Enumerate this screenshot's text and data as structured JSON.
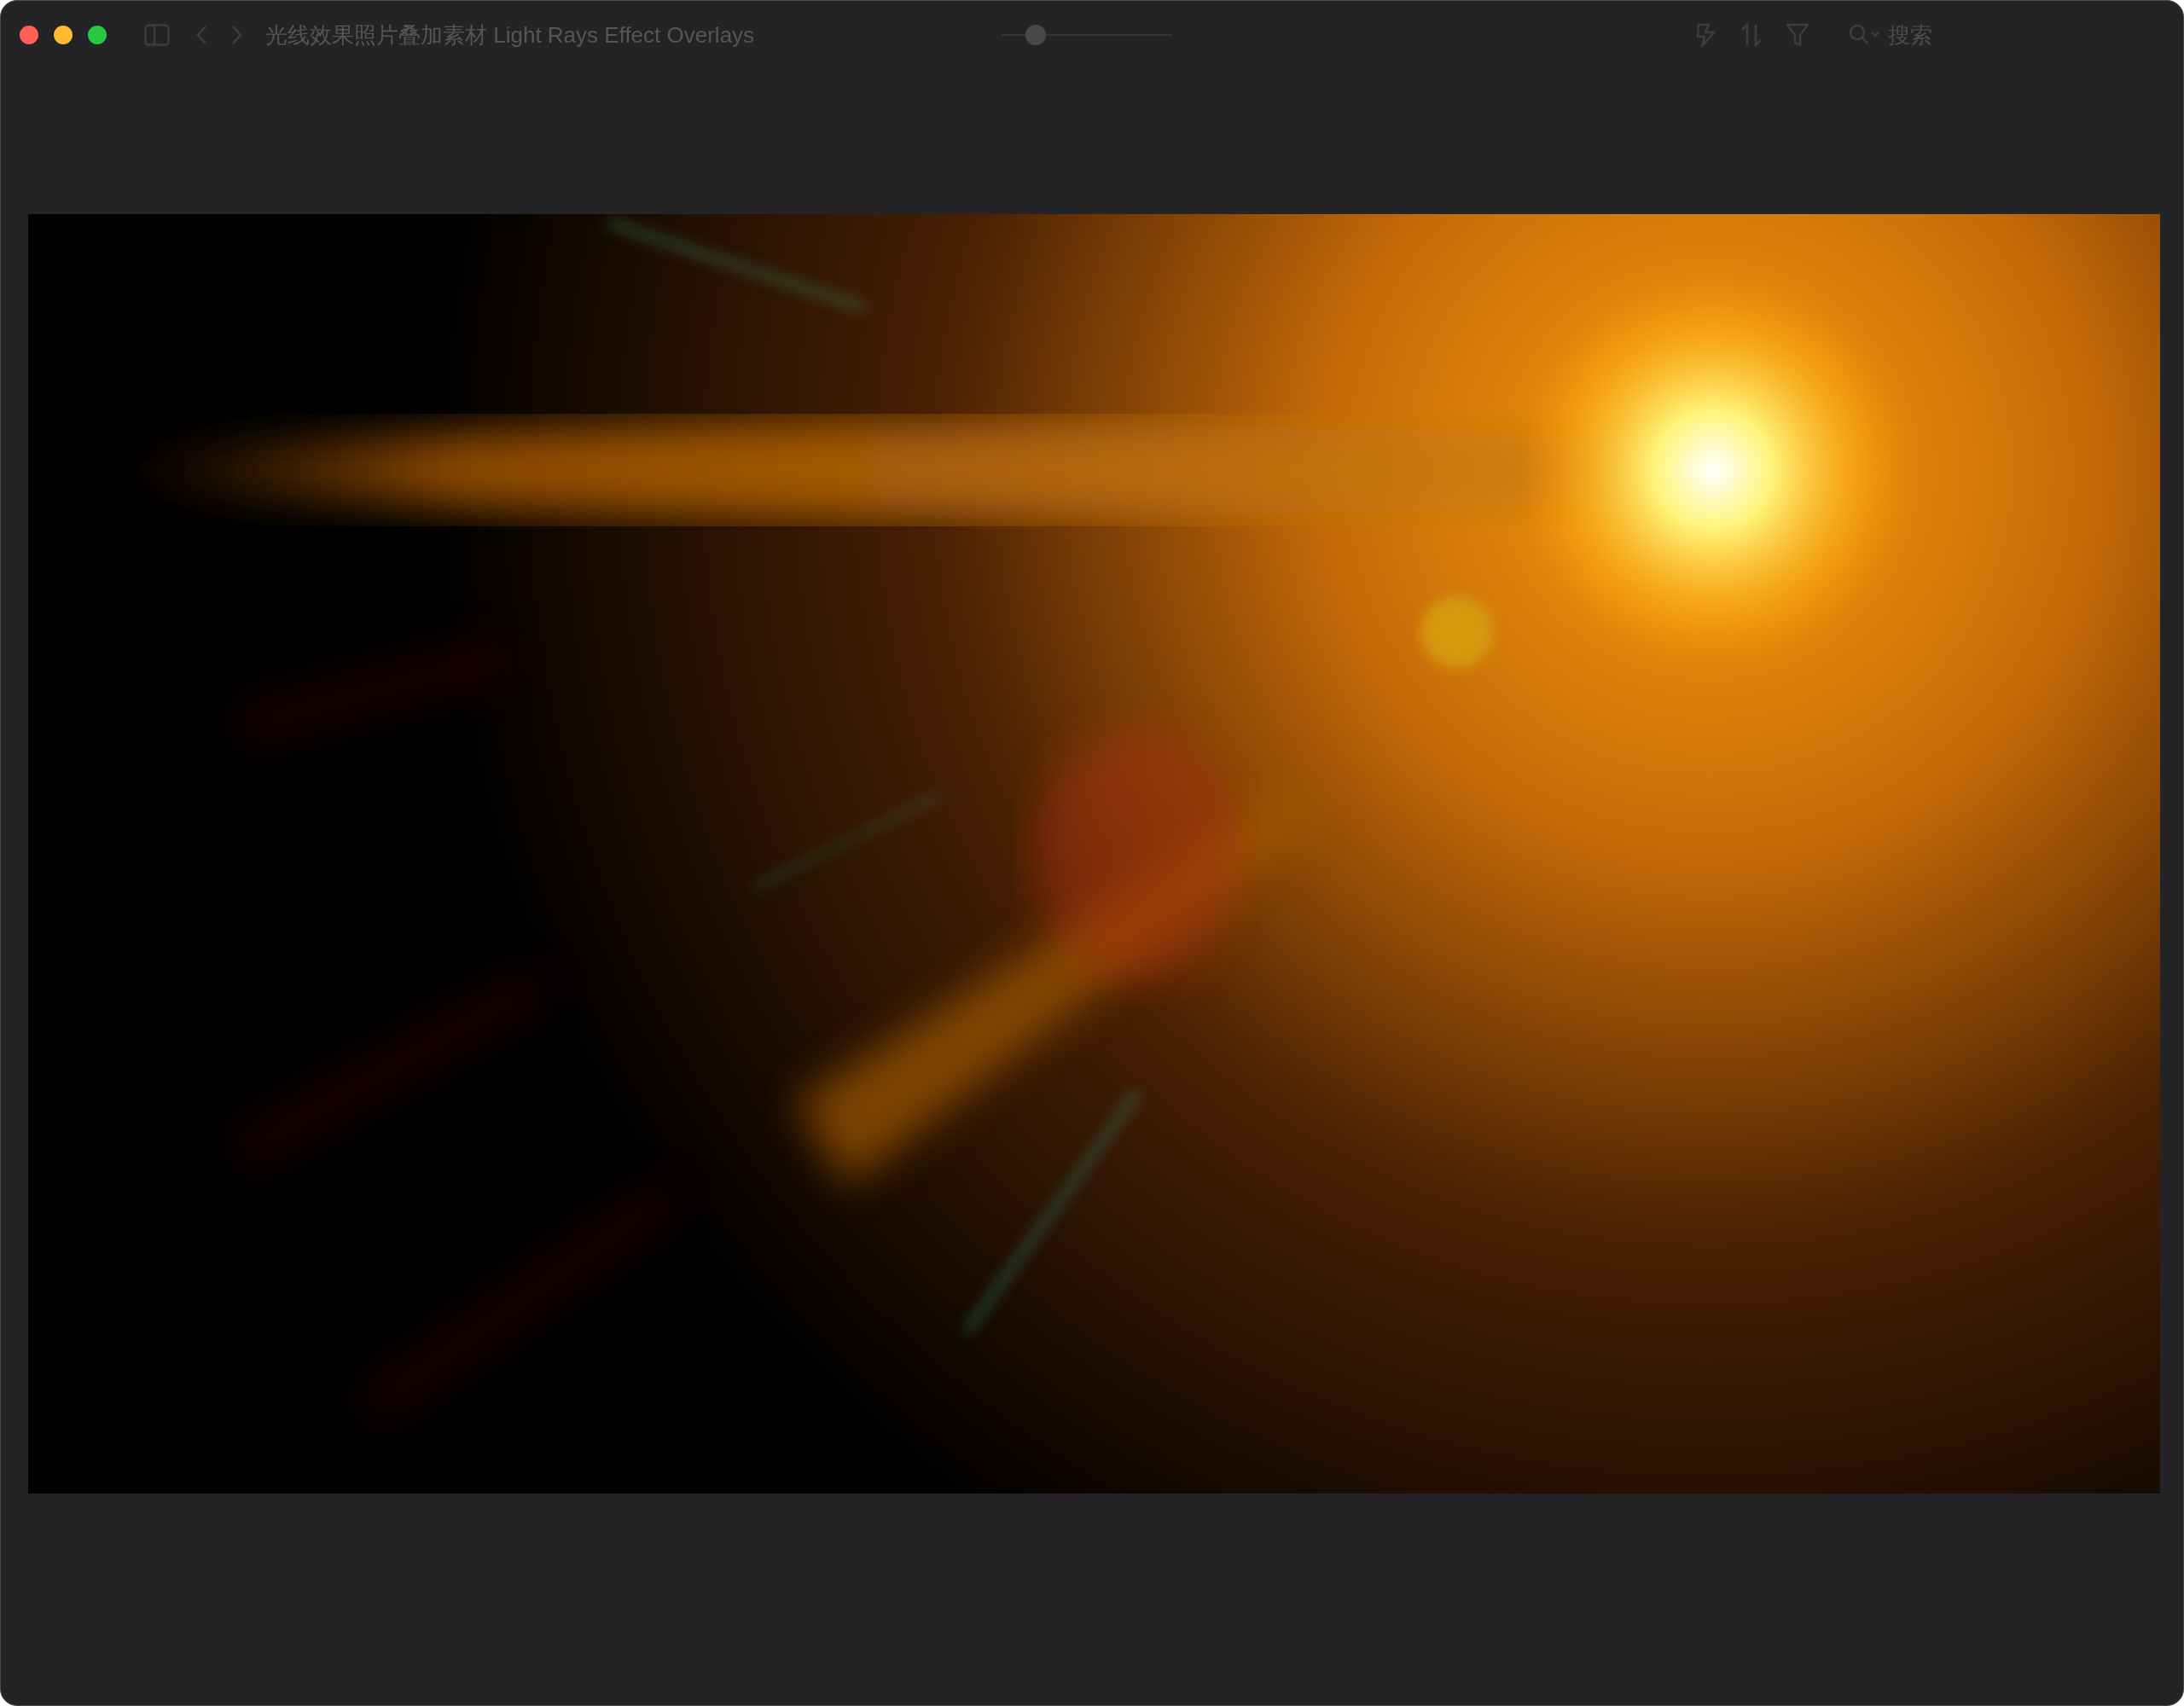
{
  "window": {
    "title": "光线效果照片叠加素材 Light Rays Effect Overlays"
  },
  "toolbar": {
    "zoom_slider": {
      "level": 0.2
    },
    "search": {
      "placeholder": "搜索"
    }
  }
}
